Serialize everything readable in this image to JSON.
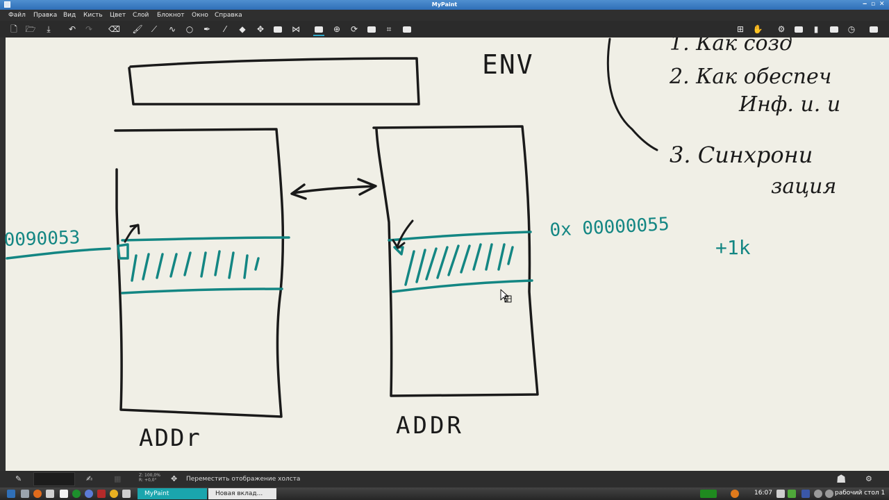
{
  "window": {
    "title": "MyPaint",
    "controls": [
      "‒",
      "▫",
      "✕"
    ]
  },
  "menu": [
    "Файл",
    "Правка",
    "Вид",
    "Кисть",
    "Цвет",
    "Слой",
    "Блокнот",
    "Окно",
    "Справка"
  ],
  "toolbar_icons": [
    "new-icon",
    "open-icon",
    "save-icon",
    "undo-icon",
    "redo-icon",
    "eraser-icon",
    "brush-icon",
    "line-icon",
    "curve-icon",
    "ellipse-icon",
    "pen-icon",
    "color-picker-icon",
    "fill-icon",
    "move-icon",
    "frame-icon",
    "symmetry-icon",
    "pan-icon",
    "zoom-icon",
    "rotate-icon",
    "flip-icon",
    "crop-icon",
    "layer-icon"
  ],
  "right_toolbar_icons": [
    "gamepad-icon",
    "hand-icon",
    "gear-icon",
    "panel-icon",
    "trash-icon",
    "panel-icon-2",
    "panel-icon-3",
    "clock-icon",
    "panel-icon-4"
  ],
  "canvas": {
    "labels": {
      "env": "ENV",
      "addr_left": "ADDr",
      "addr_right": "ADDR",
      "addr_value_left": "0090053",
      "addr_value_right": "0x 00000055",
      "offset": "+1k",
      "list_1": "1. Как созд",
      "list_2": "2. Как обеспеч",
      "list_2b": "Инф. и. и",
      "list_3": "3. Синхрони",
      "list_3b": "зация"
    },
    "colors": {
      "ink": "#1a1a1a",
      "teal": "#138683",
      "paper": "#f0efe6"
    }
  },
  "status": {
    "message": "Переместить отображение холста",
    "zoom": "Z: 100,0%",
    "rotation": "R: +0,0°"
  },
  "taskbar": {
    "tasks": [
      "MyPaint",
      "Новая вклад..."
    ],
    "clock": "16:07",
    "desktop": "рабочий стол 1"
  }
}
